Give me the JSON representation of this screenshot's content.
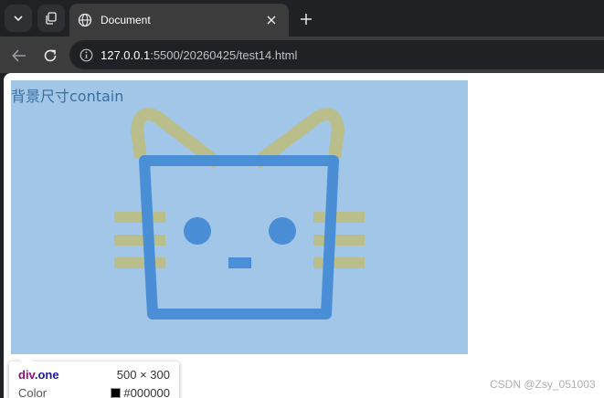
{
  "tab": {
    "title": "Document"
  },
  "address_bar": {
    "host": "127.0.0.1",
    "rest": ":5500/20260425/test14.html"
  },
  "page": {
    "box_label": "背景尺寸contain",
    "colors": {
      "box_background": "#a1c6e8",
      "cat_body": "#4a8fd6",
      "cat_ears_whiskers": "#b9be8a"
    }
  },
  "inspector_tooltip": {
    "tag": "div",
    "class": ".one",
    "size": "500 × 300",
    "property": "Color",
    "value": "#000000"
  },
  "watermark": "CSDN @Zsy_051003",
  "icons": {
    "search_tabs": "chevron-down-icon",
    "workspaces": "workspaces-icon",
    "tab_favicon": "globe-icon",
    "close": "close-icon",
    "new_tab": "plus-icon",
    "back": "arrow-left-icon",
    "reload": "reload-icon",
    "site_info": "info-icon"
  }
}
